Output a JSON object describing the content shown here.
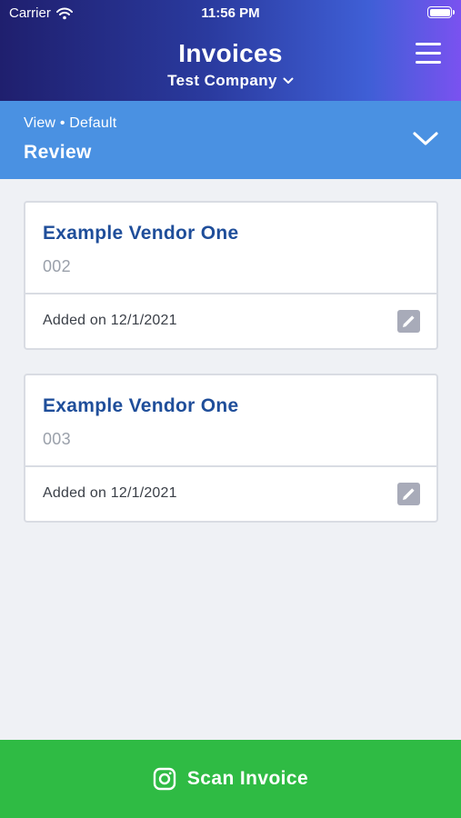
{
  "status_bar": {
    "carrier": "Carrier",
    "time": "11:56 PM"
  },
  "header": {
    "title": "Invoices",
    "company": "Test Company"
  },
  "view": {
    "label": "View • Default",
    "value": "Review"
  },
  "invoices": [
    {
      "vendor": "Example Vendor One",
      "number": "002",
      "added": "Added on 12/1/2021"
    },
    {
      "vendor": "Example Vendor One",
      "number": "003",
      "added": "Added on 12/1/2021"
    }
  ],
  "actions": {
    "scan_label": "Scan Invoice"
  },
  "colors": {
    "header_gradient": [
      "#1f1f6e",
      "#3f5fd6",
      "#7a52f0"
    ],
    "view_bar": "#4a91e2",
    "vendor_text": "#1f4e9a",
    "scan_button": "#2fbb44",
    "edit_button": "#a8abb9"
  },
  "icons": {
    "wifi": "wifi-icon",
    "battery": "battery-icon",
    "menu": "hamburger-menu-icon",
    "company_dropdown": "chevron-down-icon",
    "view_toggle": "chevron-down-icon",
    "edit": "pencil-icon",
    "scan": "camera-icon"
  }
}
